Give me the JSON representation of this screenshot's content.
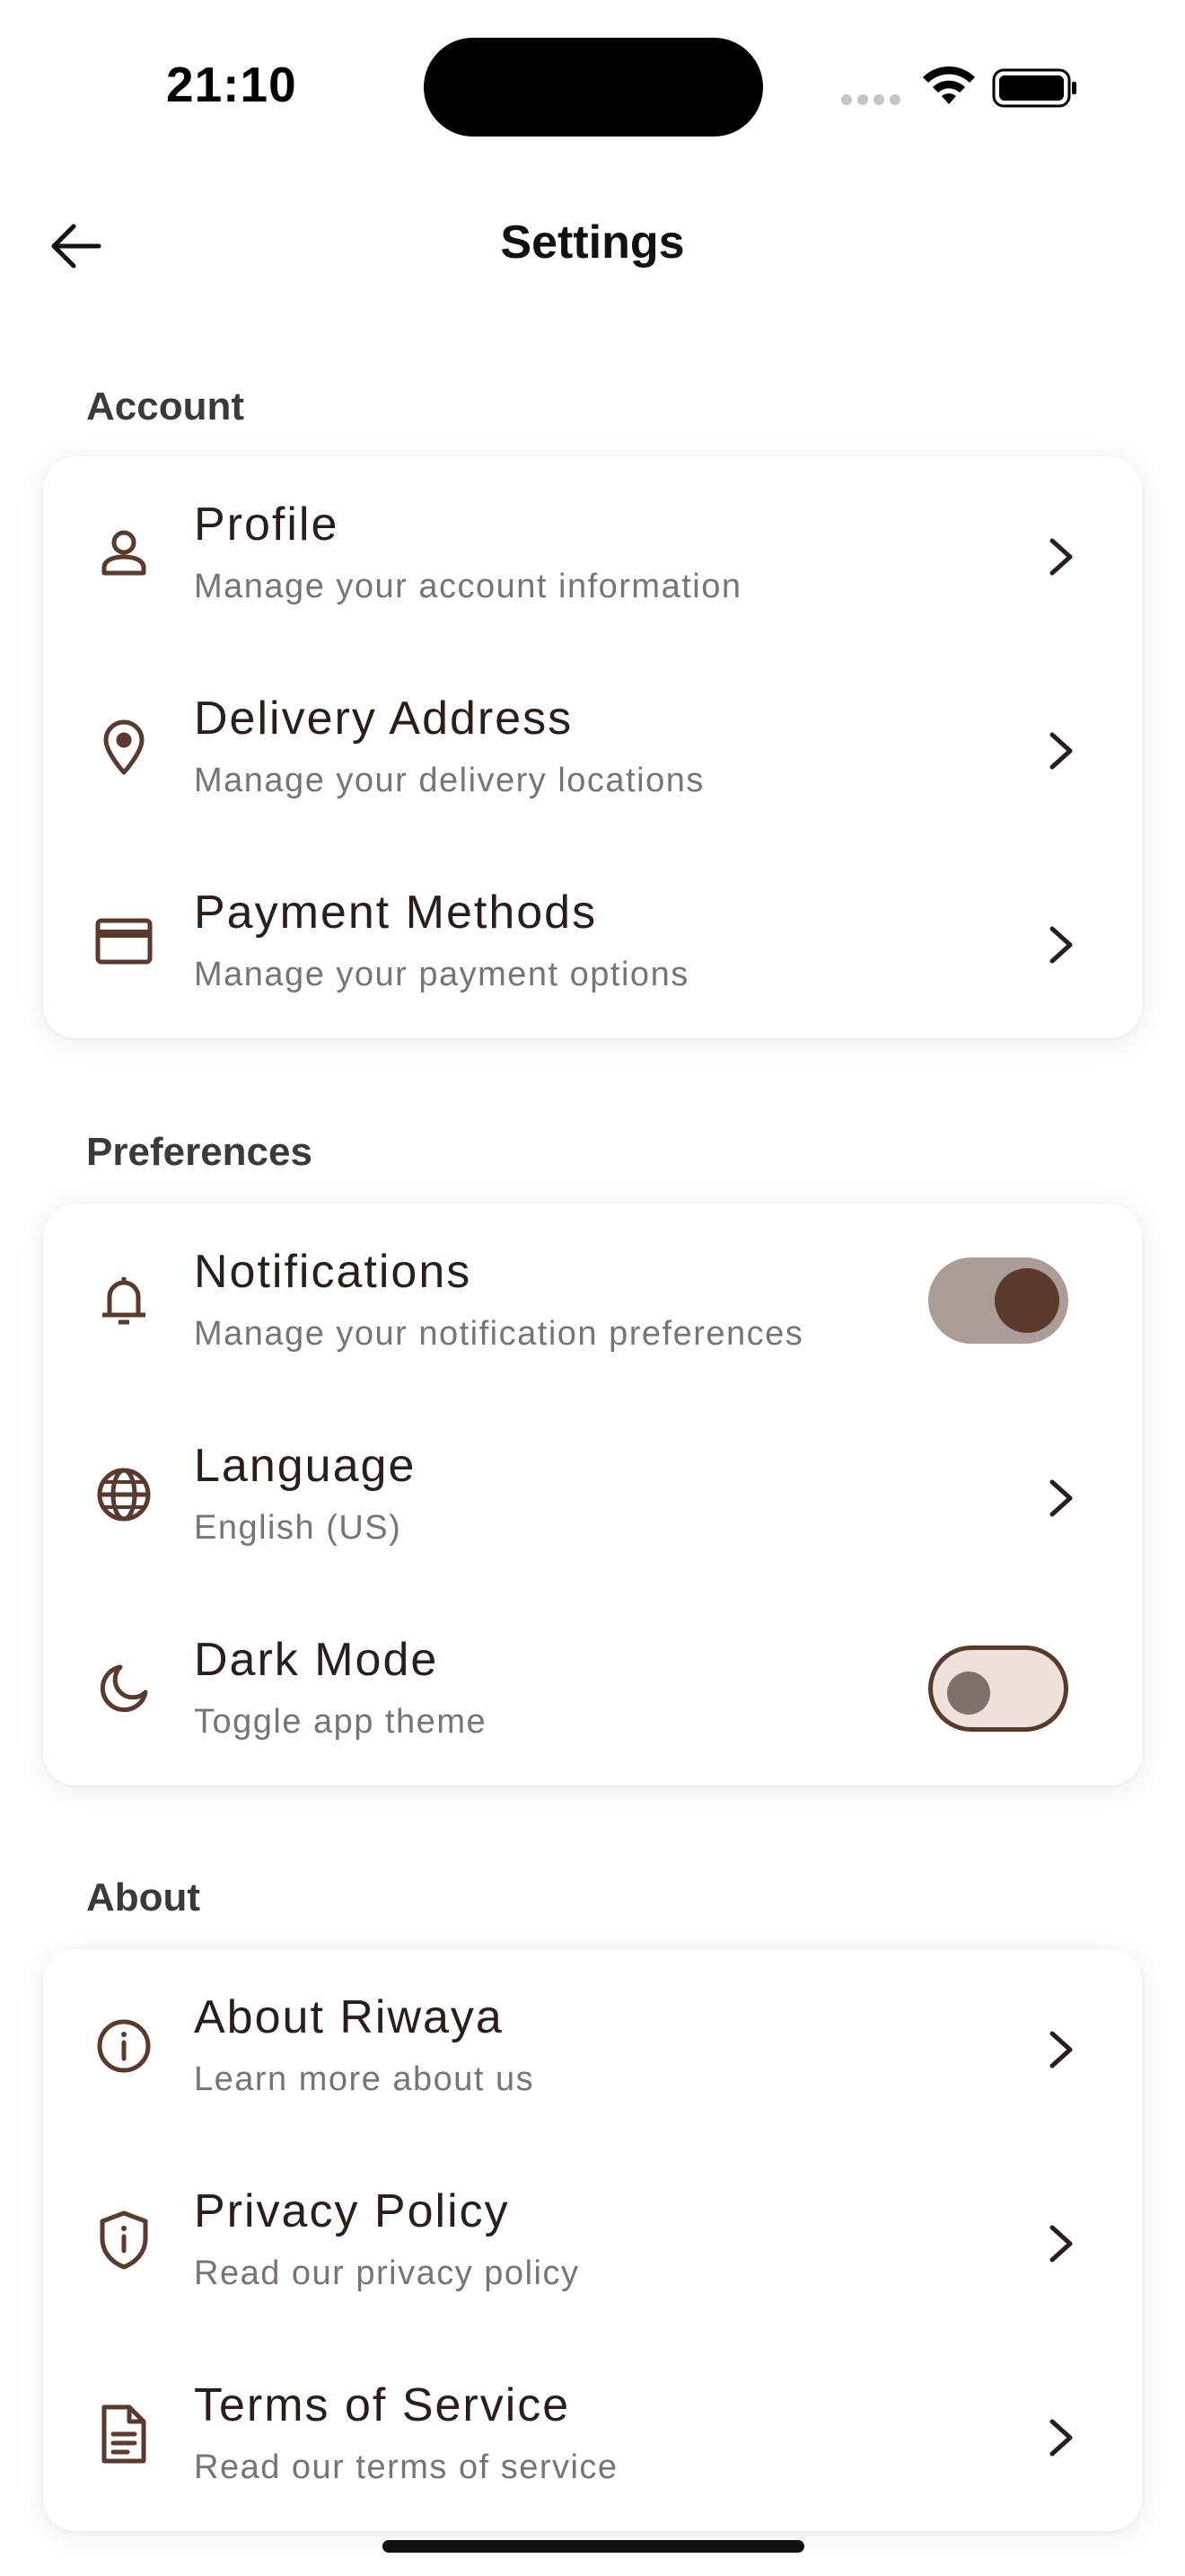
{
  "status_bar": {
    "time": "21:10"
  },
  "header": {
    "title": "Settings"
  },
  "colors": {
    "accent": "#5a3a2c",
    "toggle_on_track": "#ab9c98",
    "toggle_off_track": "#f0e0db"
  },
  "sections": [
    {
      "title": "Account",
      "items": [
        {
          "icon": "person-icon",
          "title": "Profile",
          "subtitle": "Manage your account information",
          "control": "chevron"
        },
        {
          "icon": "location-pin-icon",
          "title": "Delivery Address",
          "subtitle": "Manage your delivery locations",
          "control": "chevron"
        },
        {
          "icon": "credit-card-icon",
          "title": "Payment Methods",
          "subtitle": "Manage your payment options",
          "control": "chevron"
        }
      ]
    },
    {
      "title": "Preferences",
      "items": [
        {
          "icon": "bell-icon",
          "title": "Notifications",
          "subtitle": "Manage your notification preferences",
          "control": "toggle",
          "toggle_on": true
        },
        {
          "icon": "globe-icon",
          "title": "Language",
          "subtitle": "English (US)",
          "control": "chevron"
        },
        {
          "icon": "moon-icon",
          "title": "Dark Mode",
          "subtitle": "Toggle app theme",
          "control": "toggle",
          "toggle_on": false
        }
      ]
    },
    {
      "title": "About",
      "items": [
        {
          "icon": "info-icon",
          "title": "About Riwaya",
          "subtitle": "Learn more about us",
          "control": "chevron"
        },
        {
          "icon": "shield-icon",
          "title": "Privacy Policy",
          "subtitle": "Read our privacy policy",
          "control": "chevron"
        },
        {
          "icon": "document-icon",
          "title": "Terms of Service",
          "subtitle": "Read our terms of service",
          "control": "chevron"
        }
      ]
    }
  ]
}
